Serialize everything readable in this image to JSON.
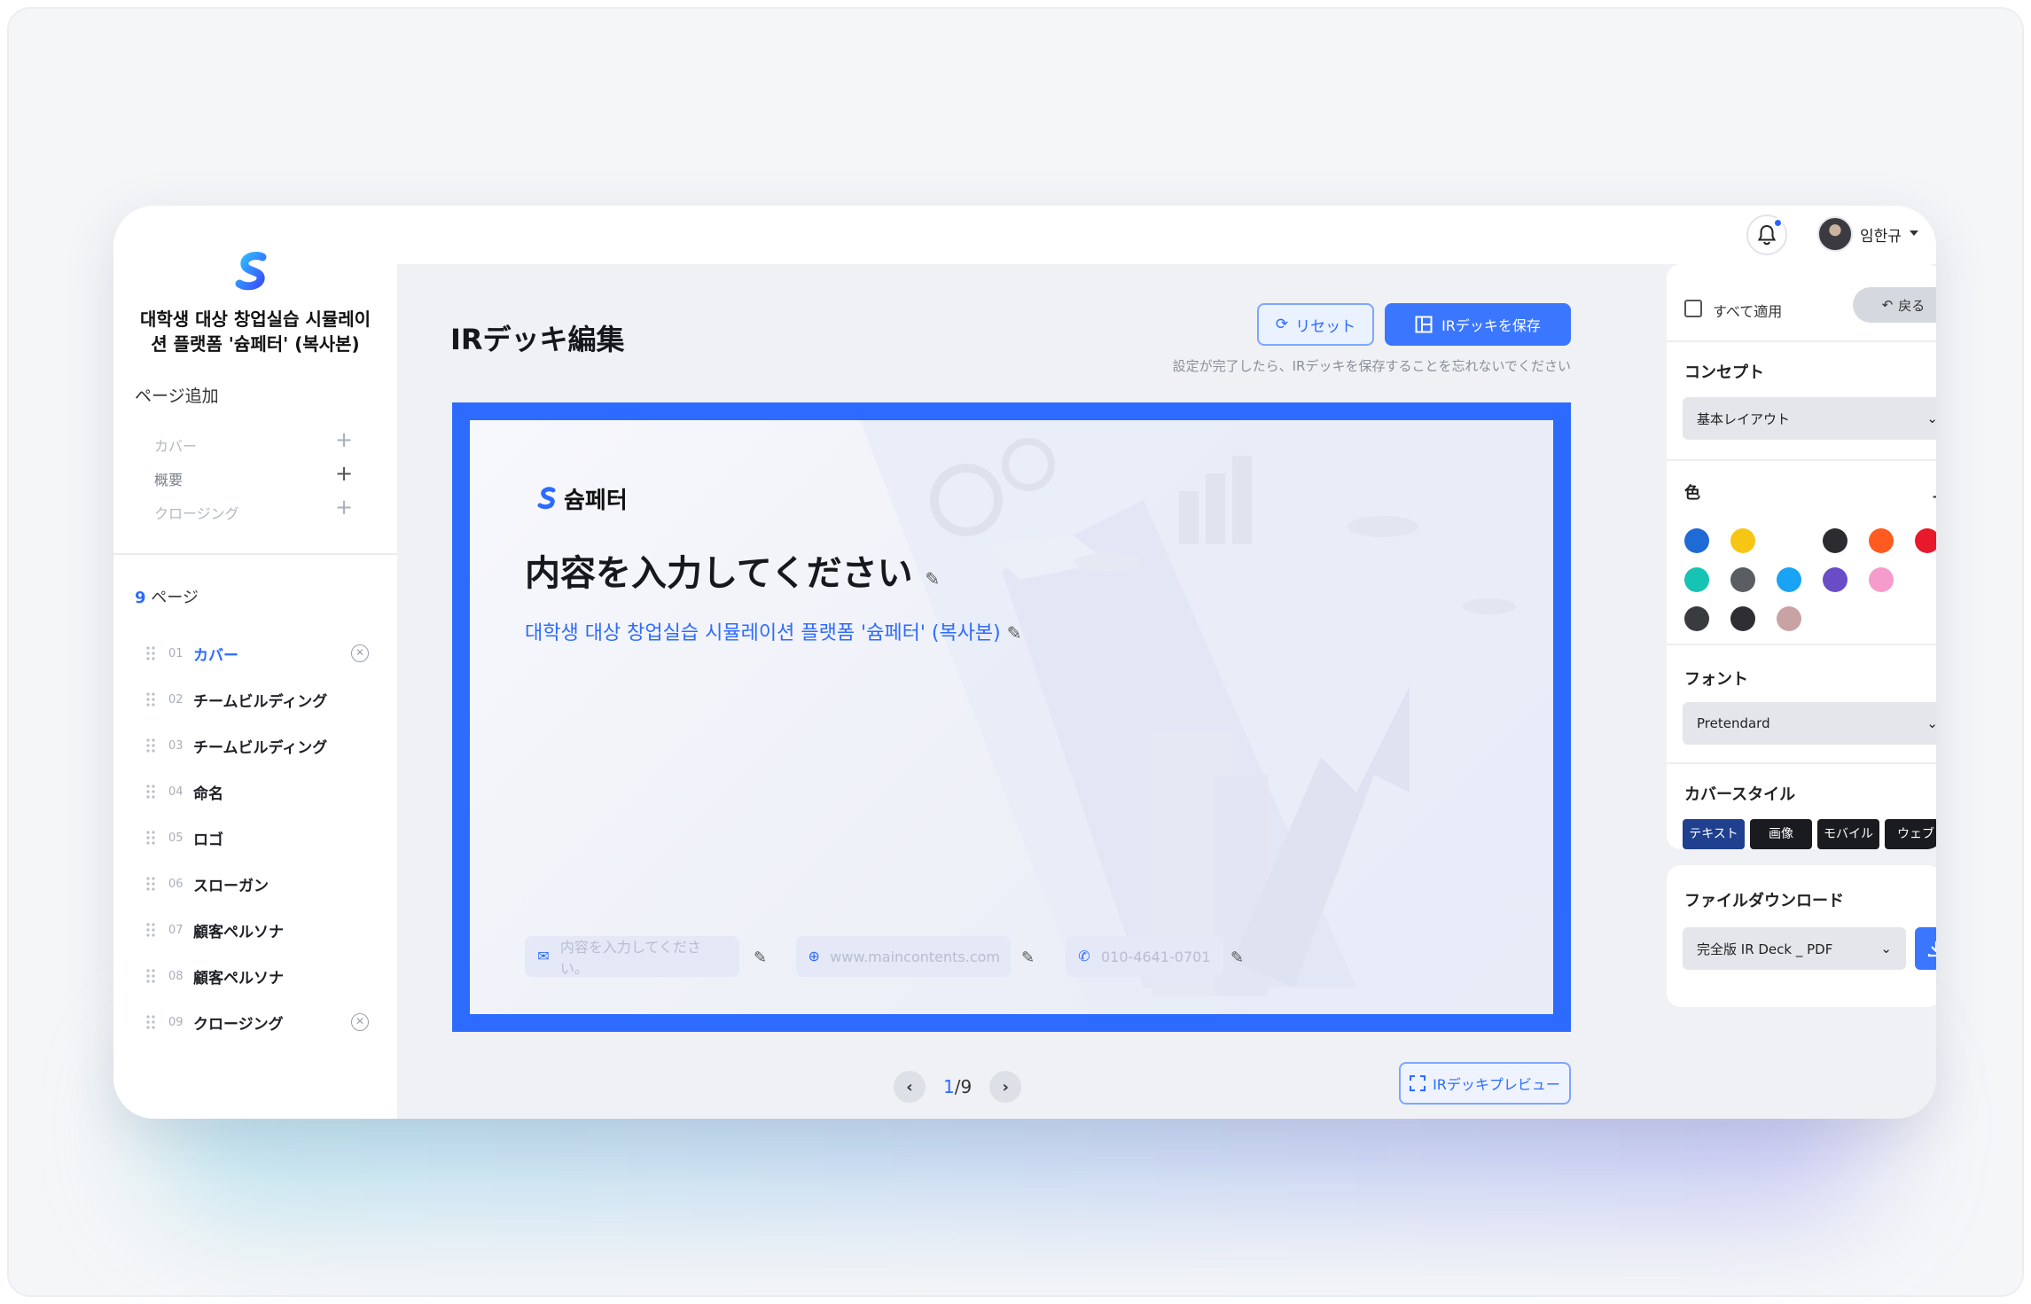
{
  "header": {
    "user_name": "임한규"
  },
  "sidebar": {
    "project_title": "대학생 대상 창업실습 시뮬레이션 플랫폼 '슘페터' (복사본)",
    "add_title": "ページ追加",
    "add_items": [
      {
        "label": "カバー"
      },
      {
        "label": "概要"
      },
      {
        "label": "クロージング"
      }
    ],
    "pages_count": "9",
    "pages_suffix": "ページ",
    "pages": [
      {
        "num": "01",
        "label": "カバー"
      },
      {
        "num": "02",
        "label": "チームビルディング"
      },
      {
        "num": "03",
        "label": "チームビルディング"
      },
      {
        "num": "04",
        "label": "命名"
      },
      {
        "num": "05",
        "label": "ロゴ"
      },
      {
        "num": "06",
        "label": "スローガン"
      },
      {
        "num": "07",
        "label": "顧客ペルソナ"
      },
      {
        "num": "08",
        "label": "顧客ペルソナ"
      },
      {
        "num": "09",
        "label": "クロージング"
      }
    ]
  },
  "main": {
    "title": "IRデッキ編集",
    "reset_label": "リセット",
    "save_label": "IRデッキを保存",
    "hint": "設定が完了したら、IRデッキを保存することを忘れないでください",
    "preview_label": "IRデッキプレビュー",
    "pager": {
      "current": "1",
      "total": "/9"
    }
  },
  "slide": {
    "brand": "슘페터",
    "title": "内容を入力してください",
    "subtitle": "대학생 대상 창업실습 시뮬레이션 플랫폼 '슘페터' (복사본)",
    "email_placeholder": "内容を入力してください。",
    "website": "www.maincontents.com",
    "phone": "010-4641-0701"
  },
  "panel": {
    "apply_all_label": "すべて適用",
    "back_label": "戻る",
    "concept_label": "コンセプト",
    "concept_value": "基本レイアウト",
    "color_label": "色",
    "colors": [
      "#1f6bd6",
      "#f7c615",
      "#2c2c30",
      "#ff5a1f",
      "#e8192c",
      "#17c3b2",
      "#5a5d62",
      "#1aa3f5",
      "#6a4cc7",
      "#f59ccd",
      "#3a3b3f",
      "#2f2f33",
      "#c9a3a3"
    ],
    "font_label": "フォント",
    "font_value": "Pretendard",
    "cover_style_label": "カバースタイル",
    "cover_styles": [
      "テキスト",
      "画像",
      "モバイル",
      "ウェブ"
    ],
    "download_label": "ファイルダウンロード",
    "download_value": "完全版 IR Deck _ PDF"
  }
}
